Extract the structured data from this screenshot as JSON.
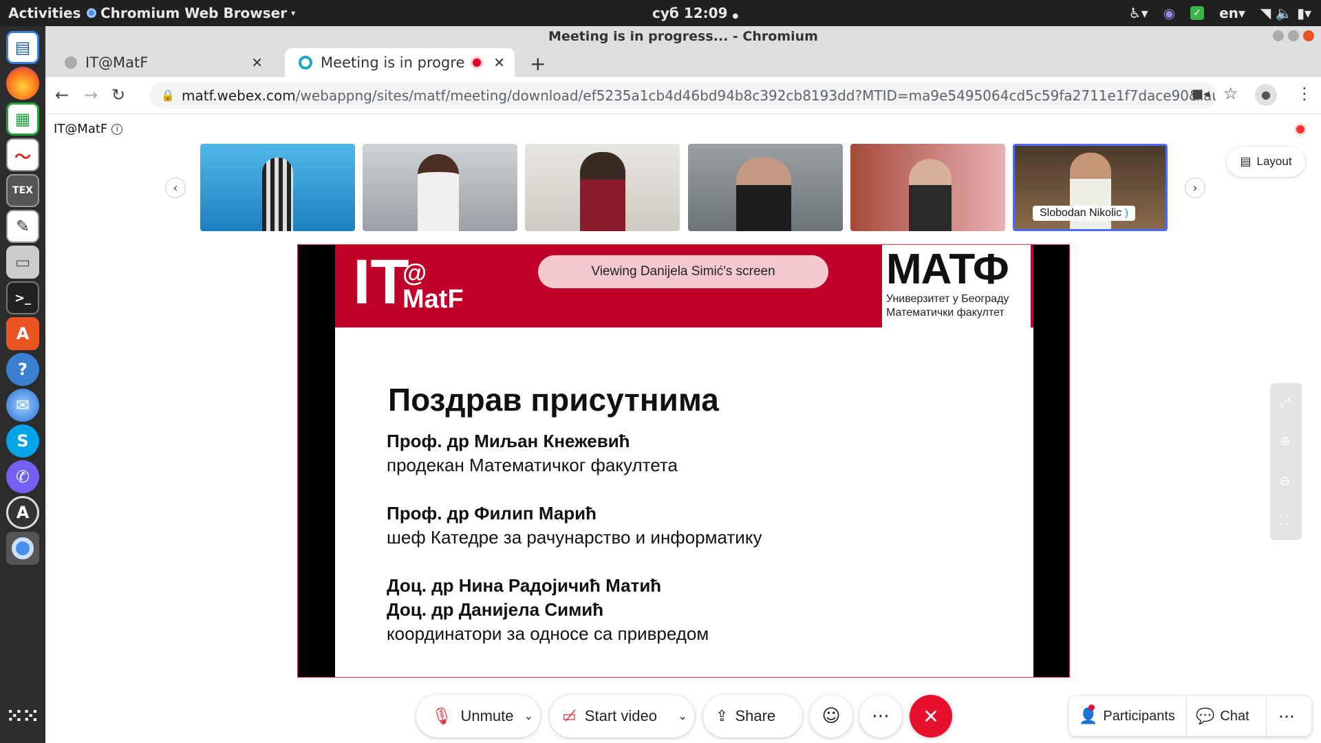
{
  "topbar": {
    "activities": "Activities",
    "app_name": "Chromium Web Browser",
    "clock": "суб 12:09",
    "lang": "en"
  },
  "window": {
    "title": "Meeting is in progress... - Chromium"
  },
  "tabs": [
    {
      "label": "IT@MatF"
    },
    {
      "label": "Meeting is in progres"
    }
  ],
  "address": {
    "url_host": "matf.webex.com",
    "url_path": "/webappng/sites/matf/meeting/download/ef5235a1cb4d46bd94b8c392cb8193dd?MTID=ma9e5495064cd5c59fa2711e1f7dace90&launchApp..."
  },
  "meeting": {
    "name": "IT@MatF",
    "layout_label": "Layout",
    "active_speaker": "Slobodan Nikolic",
    "viewing_banner": "Viewing Danijela Simić's screen"
  },
  "slide": {
    "logo_it": "IT",
    "logo_at": "@",
    "logo_matf": "MatF",
    "matf_logo": "МАТФ",
    "univ_line1": "Универзитет у Београду",
    "univ_line2": "Математички факултет",
    "heading": "Поздрав присутнима",
    "blocks": [
      {
        "lines": [
          "Проф. др Миљан Кнежевић"
        ],
        "role": "продекан Математичког факултета"
      },
      {
        "lines": [
          "Проф. др Филип Марић"
        ],
        "role": "шеф Катедре за рачунарство и информатику"
      },
      {
        "lines": [
          "Доц. др Нина Радојичић Матић",
          "Доц. др Данијела Симић"
        ],
        "role": "координатори за односе са привредом"
      }
    ]
  },
  "controls": {
    "unmute": "Unmute",
    "start_video": "Start video",
    "share": "Share",
    "participants": "Participants",
    "chat": "Chat"
  }
}
